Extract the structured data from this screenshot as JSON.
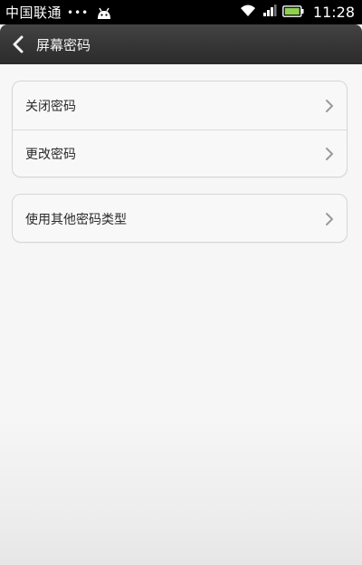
{
  "status_bar": {
    "carrier": "中国联通",
    "dots": "•••",
    "time": "11:28"
  },
  "header": {
    "title": "屏幕密码"
  },
  "groups": [
    {
      "items": [
        {
          "label": "关闭密码"
        },
        {
          "label": "更改密码"
        }
      ]
    },
    {
      "items": [
        {
          "label": "使用其他密码类型"
        }
      ]
    }
  ],
  "icons": {
    "back": "back-arrow-icon",
    "chevron": "chevron-right-icon",
    "wifi": "wifi-icon",
    "signal": "signal-icon",
    "battery": "battery-icon",
    "notification": "android-icon"
  },
  "colors": {
    "battery_fill": "#8fd14f",
    "title_bar": "#343434"
  }
}
